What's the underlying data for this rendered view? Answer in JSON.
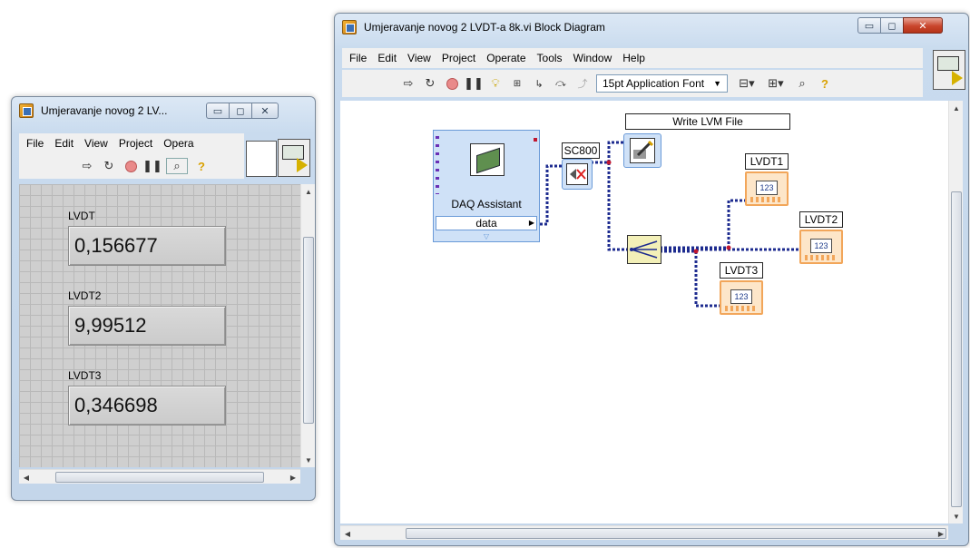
{
  "front_panel": {
    "title": "Umjeravanje novog 2 LV...",
    "menu": [
      "File",
      "Edit",
      "View",
      "Project",
      "Opera"
    ],
    "indicators": [
      {
        "label": "LVDT",
        "value": "0,156677"
      },
      {
        "label": "LVDT2",
        "value": "9,99512"
      },
      {
        "label": "LVDT3",
        "value": "0,346698"
      }
    ]
  },
  "block_diagram": {
    "title": "Umjeravanje novog 2 LVDT-a 8k.vi Block Diagram",
    "menu": [
      "File",
      "Edit",
      "View",
      "Project",
      "Operate",
      "Tools",
      "Window",
      "Help"
    ],
    "font_selector": "15pt Application Font",
    "daq": {
      "label": "DAQ Assistant",
      "output": "data"
    },
    "sc800_label": "SC800",
    "write_lvm_label": "Write LVM File",
    "indicators": [
      "LVDT1",
      "LVDT2",
      "LVDT3"
    ],
    "numeric_glyph": "123"
  },
  "colors": {
    "wire": "#1d2b8f",
    "indicator_border": "#f2a65a",
    "selection_blue": "#6a9ad8"
  }
}
